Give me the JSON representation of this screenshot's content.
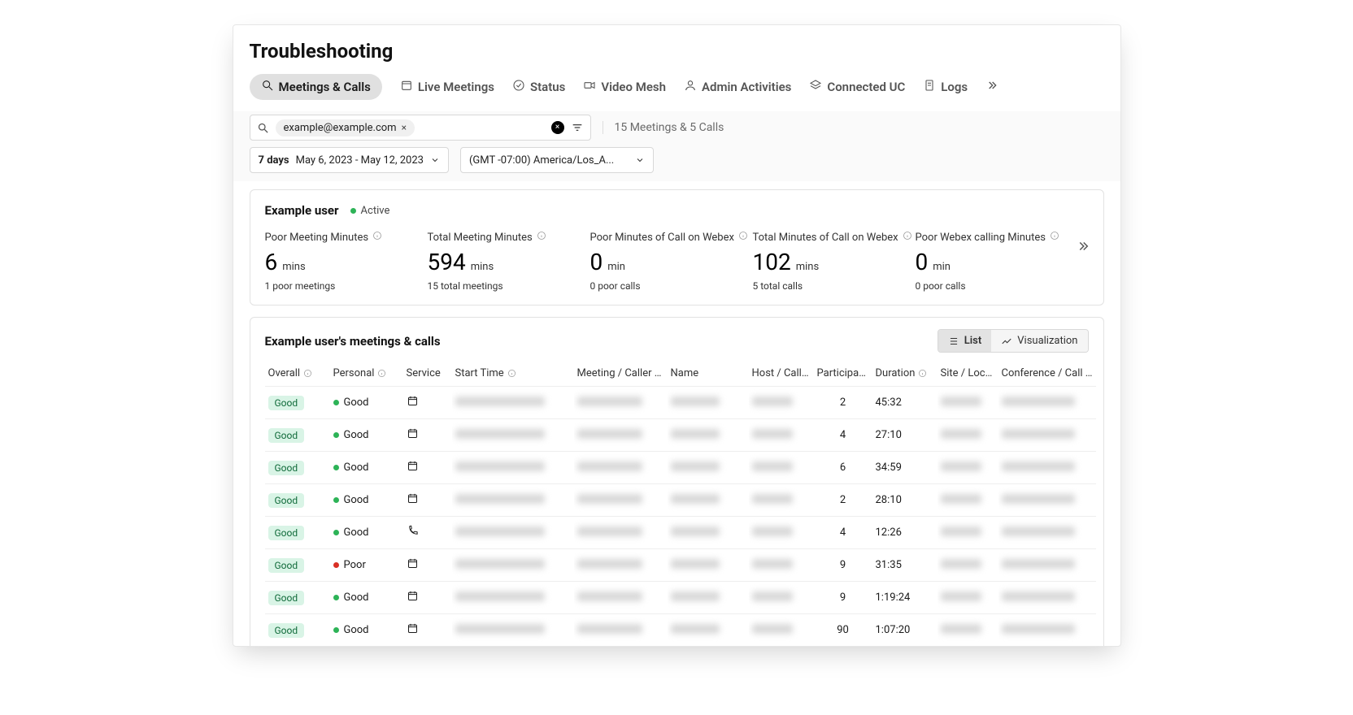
{
  "page_title": "Troubleshooting",
  "tabs": {
    "meetings_calls": "Meetings & Calls",
    "live_meetings": "Live Meetings",
    "status": "Status",
    "video_mesh": "Video Mesh",
    "admin_activities": "Admin Activities",
    "connected_uc": "Connected UC",
    "logs": "Logs"
  },
  "search": {
    "chip_value": "example@example.com",
    "result_summary": "15 Meetings & 5 Calls"
  },
  "range": {
    "label": "7 days",
    "dates": "May 6, 2023 - May 12, 2023"
  },
  "timezone": {
    "value": "(GMT -07:00) America/Los_A..."
  },
  "user": {
    "name": "Example user",
    "status": "Active"
  },
  "metrics": [
    {
      "label": "Poor Meeting Minutes",
      "value": "6",
      "unit": "mins",
      "sub": "1 poor meetings"
    },
    {
      "label": "Total Meeting Minutes",
      "value": "594",
      "unit": "mins",
      "sub": "15 total meetings"
    },
    {
      "label": "Poor Minutes of Call on Webex",
      "value": "0",
      "unit": "min",
      "sub": "0 poor calls"
    },
    {
      "label": "Total Minutes of Call on Webex",
      "value": "102",
      "unit": "mins",
      "sub": "5 total calls"
    },
    {
      "label": "Poor Webex calling Minutes",
      "value": "0",
      "unit": "min",
      "sub": "0 poor calls"
    }
  ],
  "table": {
    "title": "Example user's meetings & calls",
    "view_list": "List",
    "view_viz": "Visualization",
    "cols": {
      "overall": "Overall",
      "personal": "Personal",
      "service": "Service",
      "start": "Start Time",
      "num": "Meeting / Caller num",
      "name": "Name",
      "host": "Host / Caller",
      "participants": "Participants",
      "duration": "Duration",
      "site": "Site / Location",
      "conf": "Conference / Call ID"
    },
    "rows": [
      {
        "overall": "Good",
        "personal": "Good",
        "personal_color": "green",
        "service": "calendar",
        "participants": "2",
        "duration": "45:32"
      },
      {
        "overall": "Good",
        "personal": "Good",
        "personal_color": "green",
        "service": "calendar",
        "participants": "4",
        "duration": "27:10"
      },
      {
        "overall": "Good",
        "personal": "Good",
        "personal_color": "green",
        "service": "calendar",
        "participants": "6",
        "duration": "34:59"
      },
      {
        "overall": "Good",
        "personal": "Good",
        "personal_color": "green",
        "service": "calendar",
        "participants": "2",
        "duration": "28:10"
      },
      {
        "overall": "Good",
        "personal": "Good",
        "personal_color": "green",
        "service": "phone",
        "participants": "4",
        "duration": "12:26"
      },
      {
        "overall": "Good",
        "personal": "Poor",
        "personal_color": "red",
        "service": "calendar",
        "participants": "9",
        "duration": "31:35"
      },
      {
        "overall": "Good",
        "personal": "Good",
        "personal_color": "green",
        "service": "calendar",
        "participants": "9",
        "duration": "1:19:24"
      },
      {
        "overall": "Good",
        "personal": "Good",
        "personal_color": "green",
        "service": "calendar",
        "participants": "90",
        "duration": "1:07:20"
      }
    ]
  }
}
